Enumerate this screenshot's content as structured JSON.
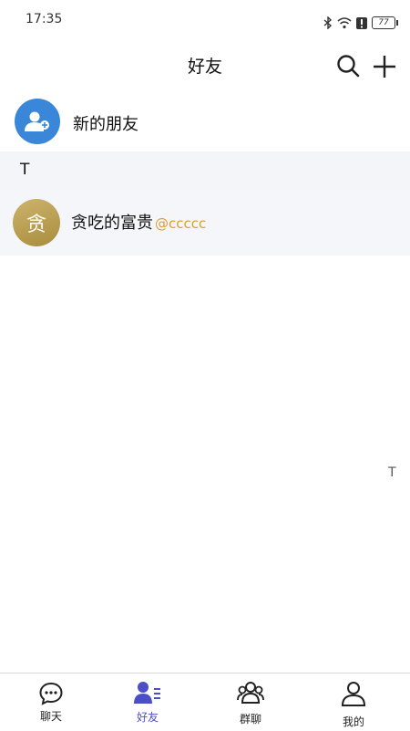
{
  "status_bar": {
    "time": "17:35",
    "battery": "77"
  },
  "header": {
    "title": "好友"
  },
  "new_friend": {
    "label": "新的朋友"
  },
  "sections": [
    {
      "letter": "T",
      "friends": [
        {
          "avatar_char": "贪",
          "name": "贪吃的富贵",
          "tag": "@ccccc"
        }
      ]
    }
  ],
  "index_bar": {
    "letter": "T"
  },
  "tabs": [
    {
      "label": "聊天",
      "icon": "chat-bubble-icon",
      "active": false
    },
    {
      "label": "好友",
      "icon": "friends-icon",
      "active": true
    },
    {
      "label": "群聊",
      "icon": "group-icon",
      "active": false
    },
    {
      "label": "我的",
      "icon": "profile-icon",
      "active": false
    }
  ],
  "colors": {
    "accent": "#4a4fc7",
    "avatar_blue": "#3a86d9",
    "tag": "#e49a2e"
  }
}
